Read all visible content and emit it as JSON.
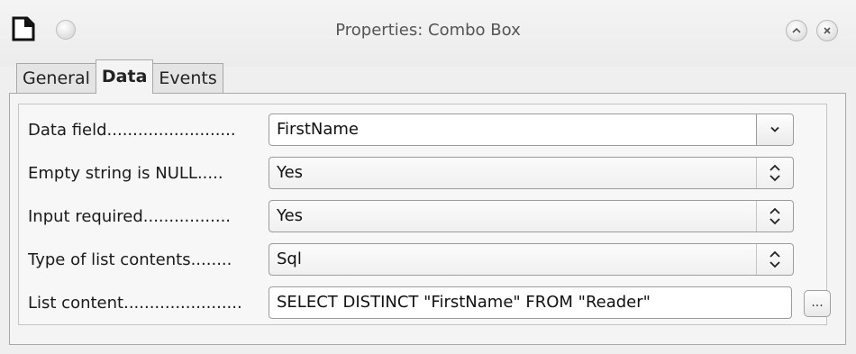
{
  "window": {
    "title": "Properties: Combo Box"
  },
  "tabs": [
    {
      "label": "General",
      "active": false
    },
    {
      "label": "Data",
      "active": true
    },
    {
      "label": "Events",
      "active": false
    }
  ],
  "fields": {
    "data_field": {
      "label": "Data field.........................",
      "value": "FirstName"
    },
    "empty_string_is_null": {
      "label": "Empty string is NULL.....",
      "value": "Yes"
    },
    "input_required": {
      "label": "Input required.................",
      "value": "Yes"
    },
    "type_of_list_contents": {
      "label": "Type of list contents........",
      "value": "Sql"
    },
    "list_content": {
      "label": "List content.......................",
      "value": "SELECT DISTINCT \"FirstName\" FROM \"Reader\"",
      "button_label": "..."
    }
  },
  "icons": {
    "app": "document-icon",
    "title_button": "menu-icon",
    "maximize": "chevron-up-icon",
    "close": "close-icon",
    "dropdown": "chevron-down-icon",
    "spin": "up-down-arrows-icon"
  }
}
